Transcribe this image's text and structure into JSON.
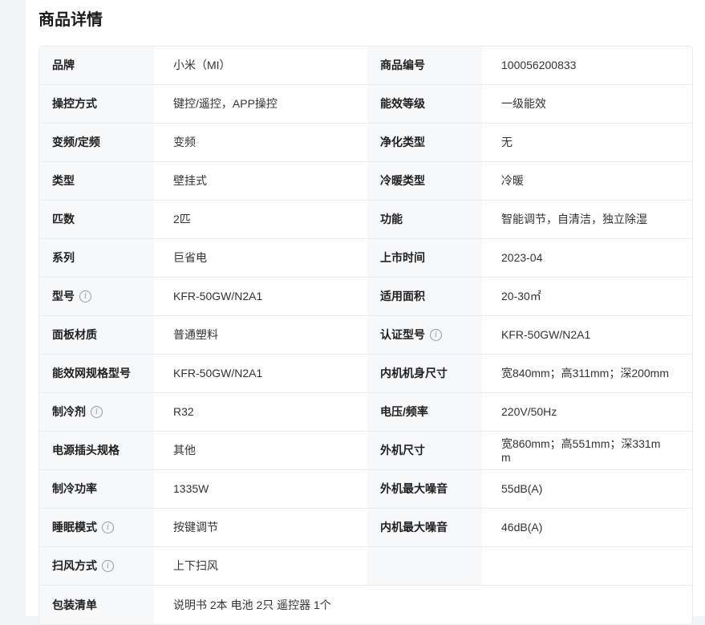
{
  "page": {
    "title": "商品详情"
  },
  "specs": [
    {
      "k1": "品牌",
      "v1": "小米（MI）",
      "k2": "商品编号",
      "v2": "100056200833"
    },
    {
      "k1": "操控方式",
      "v1": "键控/遥控，APP操控",
      "k2": "能效等级",
      "v2": "一级能效"
    },
    {
      "k1": "变频/定频",
      "v1": "变频",
      "k2": "净化类型",
      "v2": "无"
    },
    {
      "k1": "类型",
      "v1": "壁挂式",
      "k2": "冷暖类型",
      "v2": "冷暖"
    },
    {
      "k1": "匹数",
      "v1": "2匹",
      "k2": "功能",
      "v2": "智能调节，自清洁，独立除湿"
    },
    {
      "k1": "系列",
      "v1": "巨省电",
      "k2": "上市时间",
      "v2": "2023-04"
    },
    {
      "k1": "型号",
      "v1": "KFR-50GW/N2A1",
      "k2": "适用面积",
      "v2": "20-30㎡"
    },
    {
      "k1": "面板材质",
      "v1": "普通塑料",
      "k2": "认证型号",
      "v2": "KFR-50GW/N2A1"
    },
    {
      "k1": "能效网规格型号",
      "v1": "KFR-50GW/N2A1",
      "k2": "内机机身尺寸",
      "v2": "宽840mm；高311mm；深200mm"
    },
    {
      "k1": "制冷剂",
      "v1": "R32",
      "k2": "电压/频率",
      "v2": "220V/50Hz"
    },
    {
      "k1": "电源插头规格",
      "v1": "其他",
      "k2": "外机尺寸",
      "v2": "宽860mm；高551mm；深331mm"
    },
    {
      "k1": "制冷功率",
      "v1": "1335W",
      "k2": "外机最大噪音",
      "v2": "55dB(A)"
    },
    {
      "k1": "睡眠模式",
      "v1": "按键调节",
      "k2": "内机最大噪音",
      "v2": "46dB(A)"
    },
    {
      "k1": "扫风方式",
      "v1": "上下扫风",
      "k2": "",
      "v2": ""
    },
    {
      "k1": "包装清单",
      "v1": "说明书 2本 电池 2只 遥控器 1个"
    }
  ],
  "icons": {
    "info": "info-circle-icon",
    "info_glyph": "i"
  }
}
